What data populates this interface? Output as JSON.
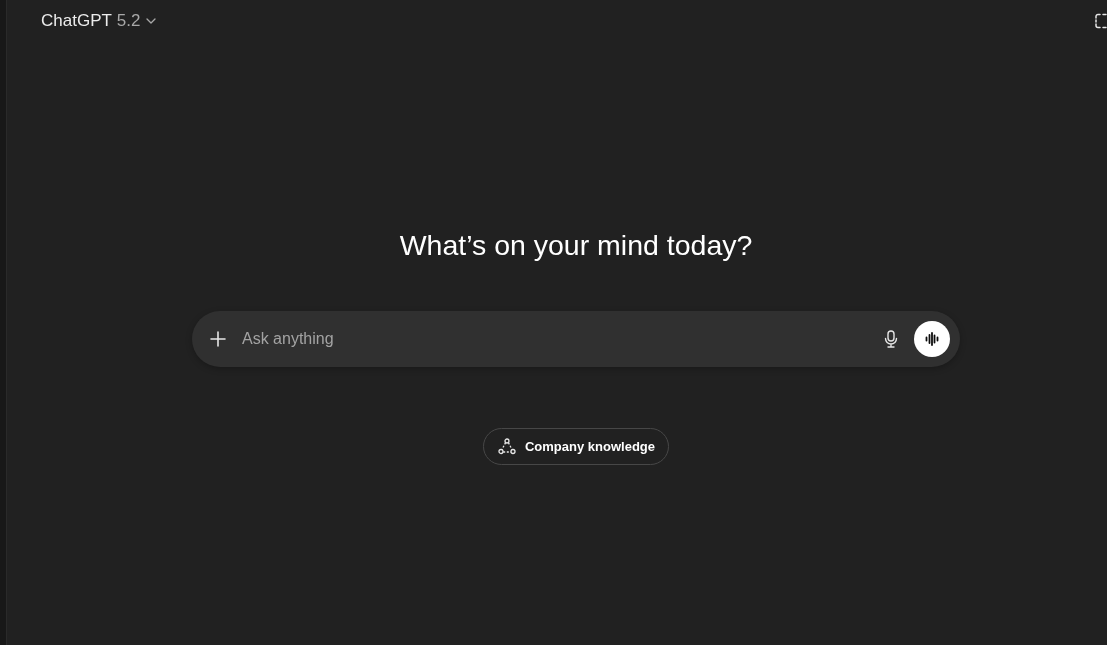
{
  "header": {
    "title": "ChatGPT",
    "version": "5.2"
  },
  "heading": "What’s on your mind today?",
  "composer": {
    "placeholder": "Ask anything"
  },
  "chips": [
    {
      "label": "Company knowledge"
    }
  ]
}
